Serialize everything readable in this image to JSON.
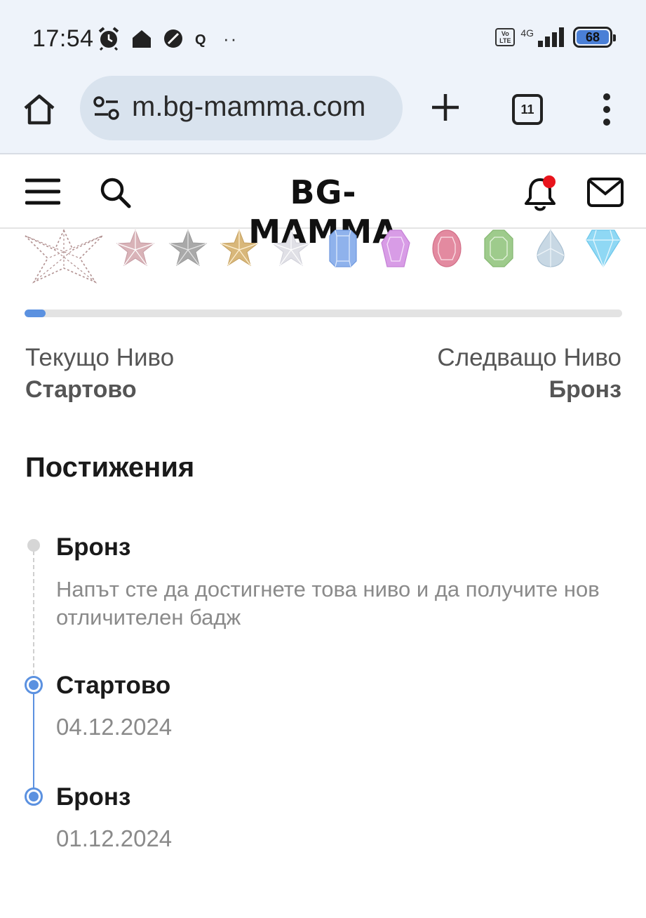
{
  "status_bar": {
    "time": "17:54",
    "network": "4G",
    "volte": "Vo LTE",
    "battery": "68",
    "indicator_dots": "··",
    "icons": [
      "alarm-icon",
      "home-icon",
      "blocked-icon",
      "notification-q-icon",
      "signal-icon",
      "battery-icon"
    ]
  },
  "browser": {
    "url": "m.bg-mamma.com",
    "tab_count": "11",
    "icons": [
      "home-icon",
      "site-settings-icon",
      "new-tab-icon",
      "tabs-icon",
      "more-menu-icon"
    ]
  },
  "site_header": {
    "logo": "BG-MAMMA",
    "icons": [
      "hamburger-icon",
      "search-icon",
      "bell-icon",
      "mail-icon"
    ],
    "accent_color": "#e8141c"
  },
  "badges": [
    {
      "name": "start-badge",
      "color": "#b08f8f"
    },
    {
      "name": "bronze-star",
      "color": "#d9b3b8"
    },
    {
      "name": "silver-star",
      "color": "#a9a9a9"
    },
    {
      "name": "gold-star",
      "color": "#d8b77a"
    },
    {
      "name": "platinum-star",
      "color": "#e0e0e6"
    },
    {
      "name": "sapphire-gem",
      "color": "#8fb2ec"
    },
    {
      "name": "amethyst-gem",
      "color": "#d89ce6"
    },
    {
      "name": "ruby-gem",
      "color": "#e38aa0"
    },
    {
      "name": "emerald-gem",
      "color": "#9ecb8c"
    },
    {
      "name": "pearl-drop",
      "color": "#c8d8e4"
    },
    {
      "name": "diamond-gem",
      "color": "#8fd8f4"
    }
  ],
  "progress": {
    "fraction": 0.035,
    "color": "#5b91e0"
  },
  "levels": {
    "current_label": "Текущо Ниво",
    "current_value": "Стартово",
    "next_label": "Следващо Ниво",
    "next_value": "Бронз"
  },
  "achievements": {
    "title": "Постижения",
    "items": [
      {
        "title": "Бронз",
        "description": "Напът сте да достигнете това ниво и да получите нов отличителен бадж",
        "state": "pending"
      },
      {
        "title": "Стартово",
        "date": "04.12.2024",
        "state": "achieved"
      },
      {
        "title": "Бронз",
        "date": "01.12.2024",
        "state": "achieved"
      }
    ]
  }
}
